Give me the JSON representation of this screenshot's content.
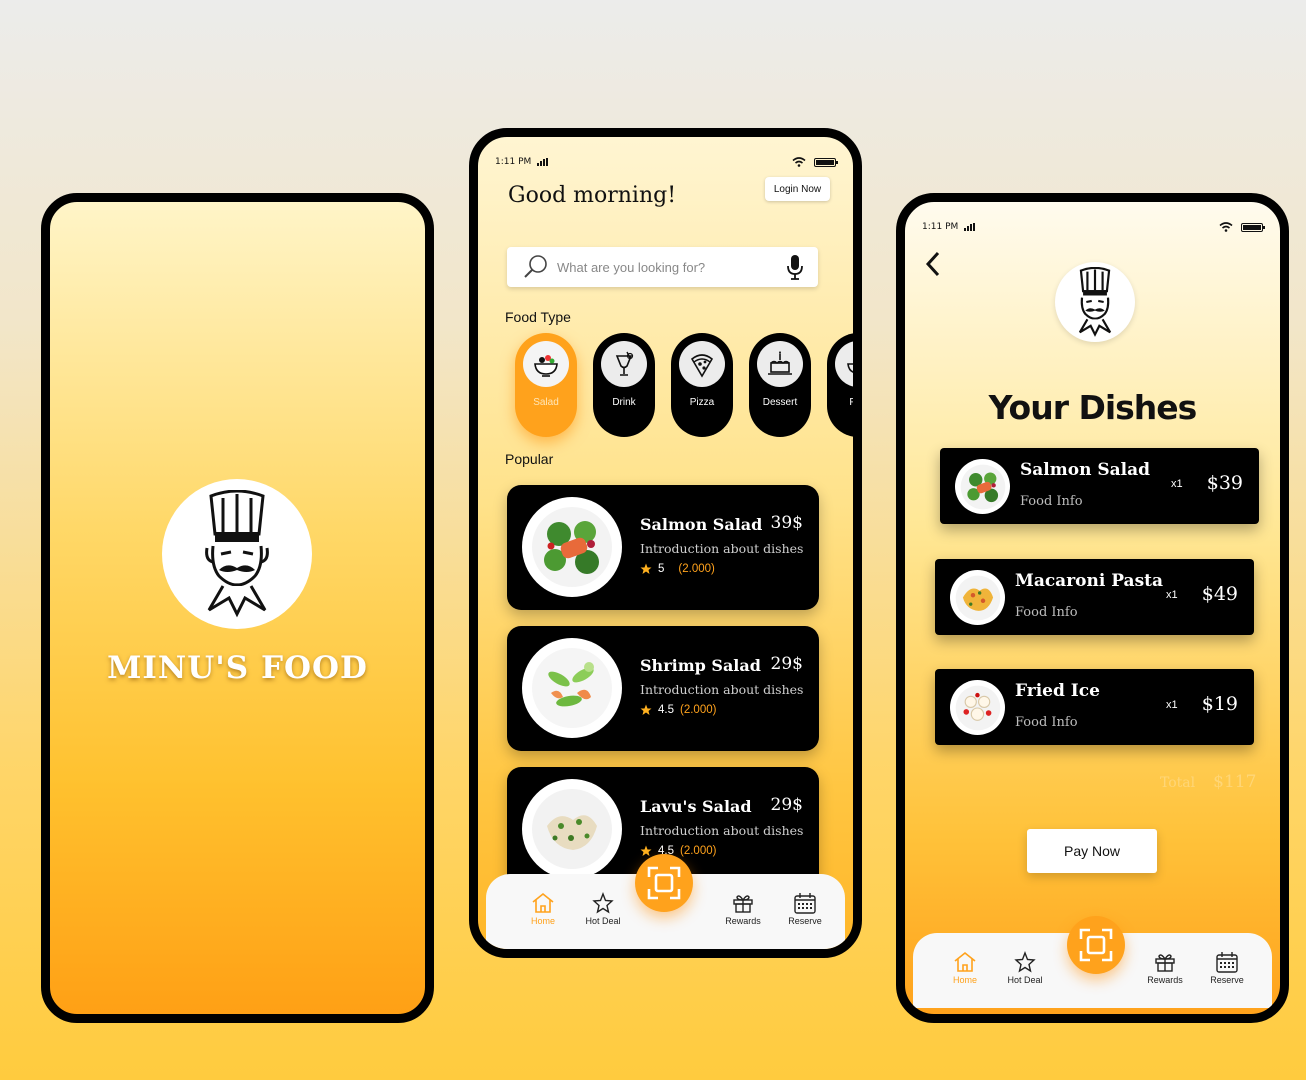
{
  "splash": {
    "brand": "MINU'S FOOD"
  },
  "status": {
    "time": "1:11 PM"
  },
  "home": {
    "greeting": "Good morning!",
    "login_label": "Login Now",
    "search_placeholder": "What are you looking for?",
    "food_type_label": "Food Type",
    "popular_label": "Popular",
    "categories": [
      {
        "label": "Salad",
        "icon": "salad-bowl-icon"
      },
      {
        "label": "Drink",
        "icon": "drink-icon"
      },
      {
        "label": "Pizza",
        "icon": "pizza-icon"
      },
      {
        "label": "Dessert",
        "icon": "cake-icon"
      },
      {
        "label": "Pas",
        "icon": "pasta-icon"
      }
    ],
    "dishes": [
      {
        "name": "Salmon Salad",
        "price": "39$",
        "description": "Introduction about dishes",
        "rating": "5",
        "reviews": "(2.000)"
      },
      {
        "name": "Shrimp Salad",
        "price": "29$",
        "description": "Introduction about dishes",
        "rating": "4.5",
        "reviews": "(2.000)"
      },
      {
        "name": "Lavu's Salad",
        "price": "29$",
        "description": "Introduction about dishes",
        "rating": "4.5",
        "reviews": "(2.000)"
      }
    ]
  },
  "tabbar": {
    "home": "Home",
    "hot_deal": "Hot Deal",
    "rewards": "Rewards",
    "reserve": "Reserve"
  },
  "dishes_page": {
    "title": "Your Dishes",
    "items": [
      {
        "name": "Salmon Salad",
        "info": "Food Info",
        "qty": "x1",
        "price": "$39"
      },
      {
        "name": "Macaroni Pasta",
        "info": "Food Info",
        "qty": "x1",
        "price": "$49"
      },
      {
        "name": "Fried Ice",
        "info": "Food Info",
        "qty": "x1",
        "price": "$19"
      }
    ],
    "total_label": "Total",
    "total_value": "$117",
    "pay_label": "Pay Now"
  },
  "colors": {
    "accent": "#ffa21c",
    "card": "#000000"
  }
}
